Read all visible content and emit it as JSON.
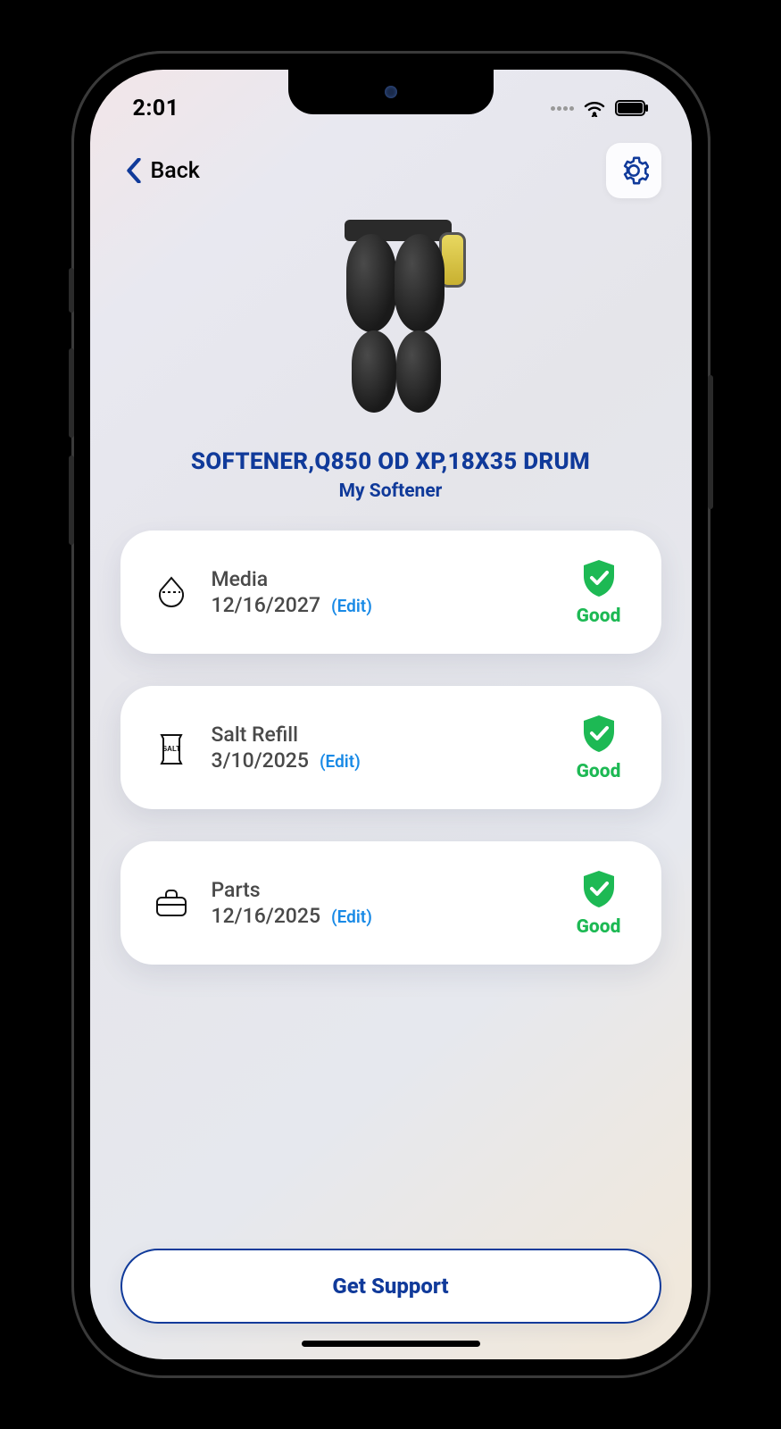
{
  "status": {
    "time": "2:01"
  },
  "nav": {
    "back_label": "Back"
  },
  "product": {
    "title": "SOFTENER,Q850 OD XP,18X35 DRUM",
    "subtitle": "My Softener"
  },
  "cards": [
    {
      "name": "Media",
      "date": "12/16/2027",
      "edit": "(Edit)",
      "status": "Good"
    },
    {
      "name": "Salt Refill",
      "date": "3/10/2025",
      "edit": "(Edit)",
      "status": "Good"
    },
    {
      "name": "Parts",
      "date": "12/16/2025",
      "edit": "(Edit)",
      "status": "Good"
    }
  ],
  "footer": {
    "support_label": "Get Support"
  },
  "colors": {
    "brand": "#103a9a",
    "good": "#1db954",
    "link": "#198ae6"
  }
}
